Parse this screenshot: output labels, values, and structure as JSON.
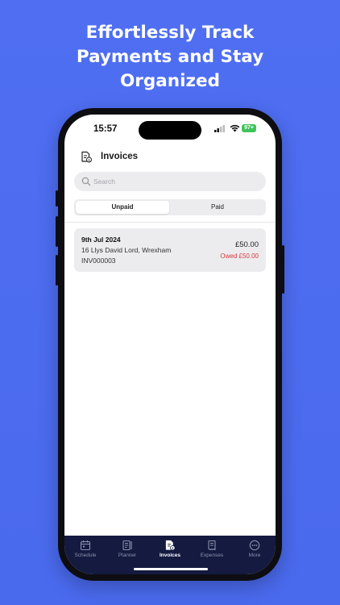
{
  "promo": {
    "headline_lines": [
      "Effortlessly Track",
      "Payments and Stay",
      "Organized"
    ]
  },
  "status_bar": {
    "time": "15:57",
    "battery": "97+"
  },
  "header": {
    "title": "Invoices",
    "icon": "invoice-icon"
  },
  "search": {
    "placeholder": "Search",
    "value": ""
  },
  "segment": {
    "tabs": [
      {
        "label": "Unpaid",
        "selected": true
      },
      {
        "label": "Paid",
        "selected": false
      }
    ]
  },
  "invoices": [
    {
      "date": "9th Jul 2024",
      "address": "16 Llys David Lord, Wrexham",
      "reference": "INV000003",
      "amount": "£50.00",
      "owed": "Owed £50.00"
    }
  ],
  "tabbar": {
    "items": [
      {
        "label": "Schedule",
        "icon": "calendar-icon",
        "active": false
      },
      {
        "label": "Planner",
        "icon": "planner-icon",
        "active": false
      },
      {
        "label": "Invoices",
        "icon": "invoice-icon",
        "active": true
      },
      {
        "label": "Expenses",
        "icon": "receipt-icon",
        "active": false
      },
      {
        "label": "More",
        "icon": "more-icon",
        "active": false
      }
    ]
  },
  "colors": {
    "background": "#4f6ef2",
    "tabbar": "#141a40",
    "owed": "#d93a3a",
    "battery": "#3fc35b"
  }
}
